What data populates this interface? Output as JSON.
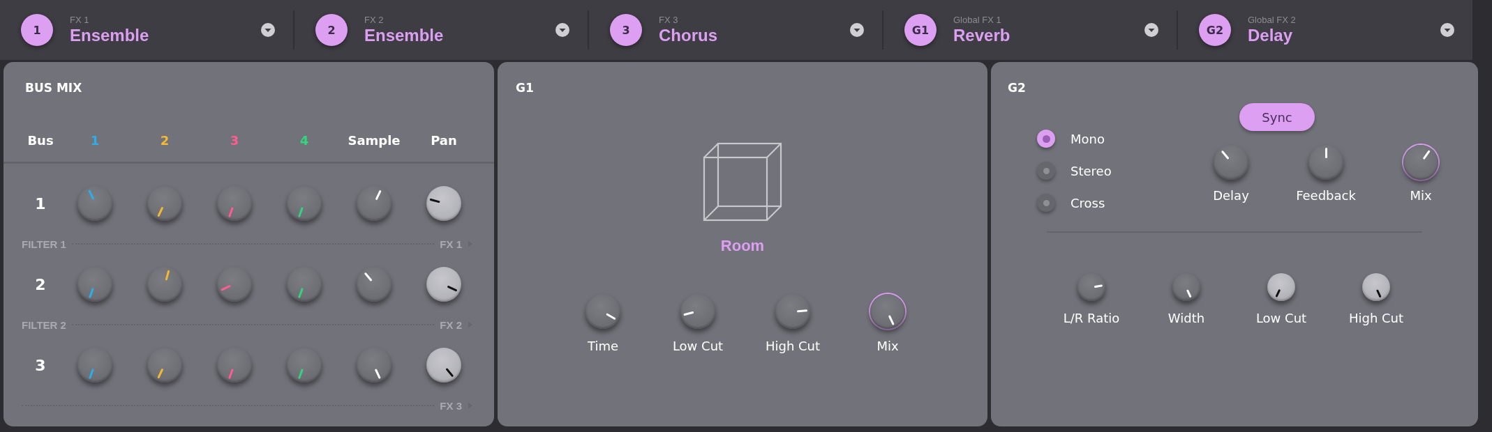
{
  "fx_slots": [
    {
      "badge": "1",
      "label": "FX 1",
      "name": "Ensemble"
    },
    {
      "badge": "2",
      "label": "FX 2",
      "name": "Ensemble"
    },
    {
      "badge": "3",
      "label": "FX 3",
      "name": "Chorus"
    },
    {
      "badge": "G1",
      "label": "Global FX 1",
      "name": "Reverb"
    },
    {
      "badge": "G2",
      "label": "Global FX 2",
      "name": "Delay"
    }
  ],
  "bus_mix": {
    "title": "BUS MIX",
    "columns": [
      {
        "label": "Bus"
      },
      {
        "label": "1",
        "color": "#2eaee8"
      },
      {
        "label": "2",
        "color": "#f5b931"
      },
      {
        "label": "3",
        "color": "#ff5c8f"
      },
      {
        "label": "4",
        "color": "#34d37e"
      },
      {
        "label": "Sample"
      },
      {
        "label": "Pan"
      }
    ],
    "rows": [
      {
        "label": "1",
        "send_left": "FILTER 1",
        "send_right": "FX 1",
        "knobs": [
          {
            "kind": "dark"
          },
          {
            "kind": "dark"
          },
          {
            "kind": "dark"
          },
          {
            "kind": "dark"
          },
          {
            "kind": "dark"
          },
          {
            "kind": "light"
          }
        ]
      },
      {
        "label": "2",
        "send_left": "FILTER 2",
        "send_right": "FX 2",
        "knobs": [
          {
            "kind": "dark"
          },
          {
            "kind": "dark"
          },
          {
            "kind": "dark"
          },
          {
            "kind": "dark"
          },
          {
            "kind": "dark"
          },
          {
            "kind": "light"
          }
        ]
      },
      {
        "label": "3",
        "send_right": "FX 3",
        "knobs": [
          {
            "kind": "dark"
          },
          {
            "kind": "dark"
          },
          {
            "kind": "dark"
          },
          {
            "kind": "dark"
          },
          {
            "kind": "dark"
          },
          {
            "kind": "light"
          }
        ]
      }
    ]
  },
  "g1": {
    "title": "G1",
    "mode": "Room",
    "knobs": [
      {
        "label": "Time",
        "kind": "dark"
      },
      {
        "label": "Low Cut",
        "kind": "dark"
      },
      {
        "label": "High Cut",
        "kind": "dark"
      },
      {
        "label": "Mix",
        "kind": "accent"
      }
    ]
  },
  "g2": {
    "title": "G2",
    "sync": {
      "label": "Sync",
      "on": true
    },
    "modes": [
      {
        "label": "Mono",
        "selected": true
      },
      {
        "label": "Stereo",
        "selected": false
      },
      {
        "label": "Cross",
        "selected": false
      }
    ],
    "top_knobs": [
      {
        "label": "Delay",
        "kind": "dark"
      },
      {
        "label": "Feedback",
        "kind": "dark"
      },
      {
        "label": "Mix",
        "kind": "accent"
      }
    ],
    "bottom_knobs": [
      {
        "label": "L/R Ratio",
        "kind": "dark"
      },
      {
        "label": "Width",
        "kind": "dark"
      },
      {
        "label": "Low Cut",
        "kind": "light"
      },
      {
        "label": "High Cut",
        "kind": "light"
      }
    ]
  }
}
